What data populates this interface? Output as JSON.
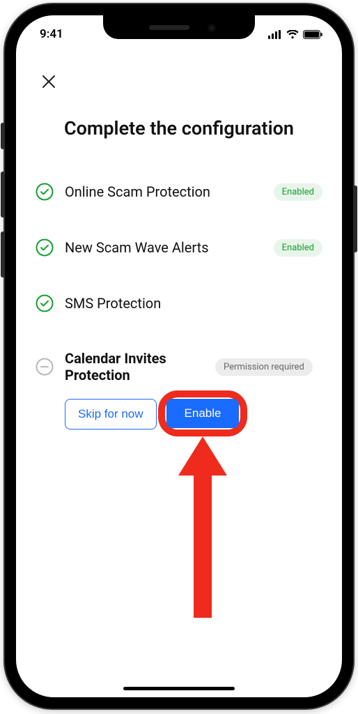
{
  "status": {
    "time": "9:41"
  },
  "title": "Complete the configuration",
  "items": [
    {
      "label": "Online Scam Protection",
      "badge": "Enabled"
    },
    {
      "label": "New Scam Wave Alerts",
      "badge": "Enabled"
    },
    {
      "label": "SMS Protection",
      "badge": ""
    },
    {
      "label": "Calendar Invites Protection",
      "badge": "Permission required"
    }
  ],
  "actions": {
    "skip": "Skip for now",
    "enable": "Enable"
  }
}
